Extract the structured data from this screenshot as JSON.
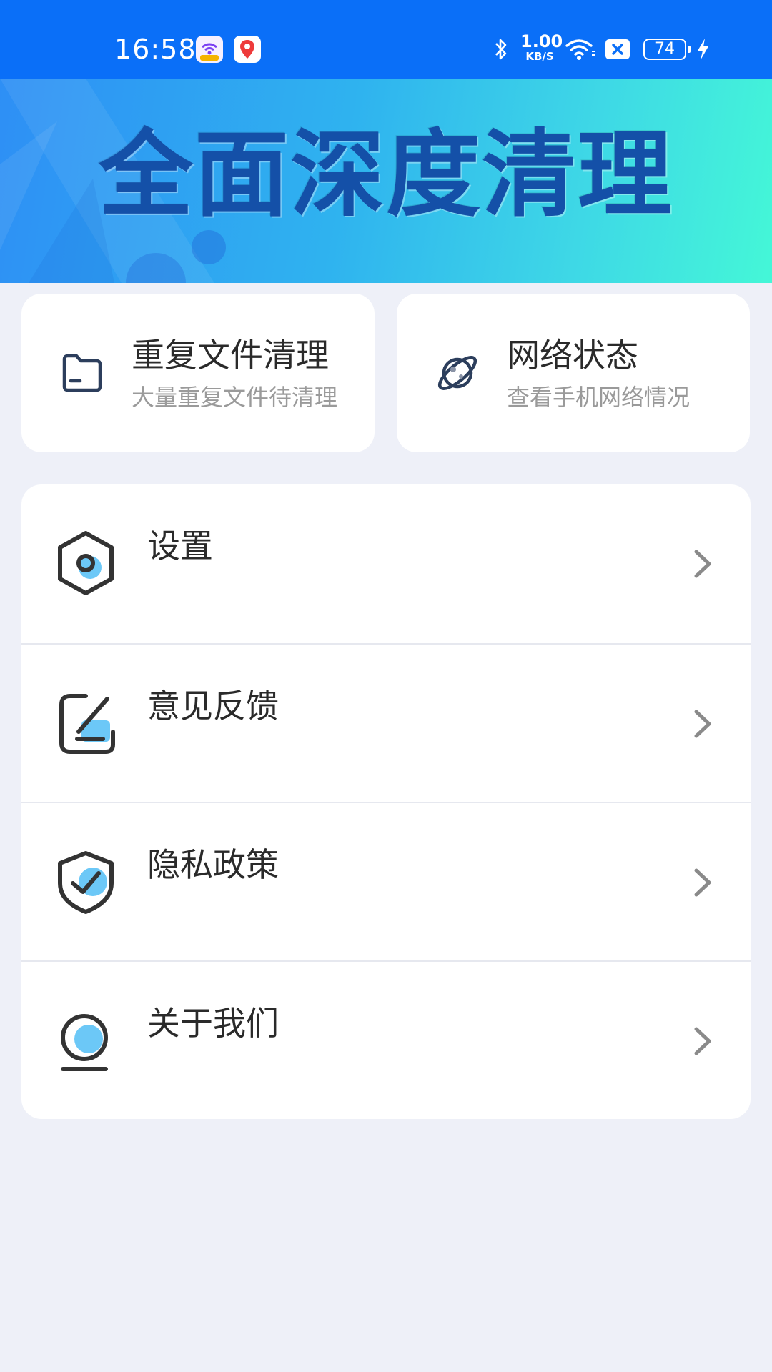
{
  "status_bar": {
    "time": "16:58",
    "net_speed_value": "1.00",
    "net_speed_unit": "KB/S",
    "battery_level": "74",
    "icons": [
      "wifi-app-icon",
      "map-app-icon",
      "bluetooth-icon",
      "wifi-icon",
      "sim-off-icon",
      "battery-icon",
      "charging-icon"
    ]
  },
  "banner": {
    "title": "全面深度清理"
  },
  "quick_actions": [
    {
      "title": "重复文件清理",
      "subtitle": "大量重复文件待清理",
      "icon": "folder-icon"
    },
    {
      "title": "网络状态",
      "subtitle": "查看手机网络情况",
      "icon": "planet-icon"
    }
  ],
  "menu": [
    {
      "label": "设置",
      "icon": "settings-hexagon-icon"
    },
    {
      "label": "意见反馈",
      "icon": "feedback-edit-icon"
    },
    {
      "label": "隐私政策",
      "icon": "shield-check-icon"
    },
    {
      "label": "关于我们",
      "icon": "user-icon"
    }
  ],
  "colors": {
    "status_bar": "#0a6ff8",
    "banner_start": "#2e8ff5",
    "banner_end": "#44f7d7",
    "banner_title": "#1450a8",
    "icon_accent": "#6cc8f7",
    "icon_stroke": "#333333",
    "background": "#eef0f8"
  }
}
